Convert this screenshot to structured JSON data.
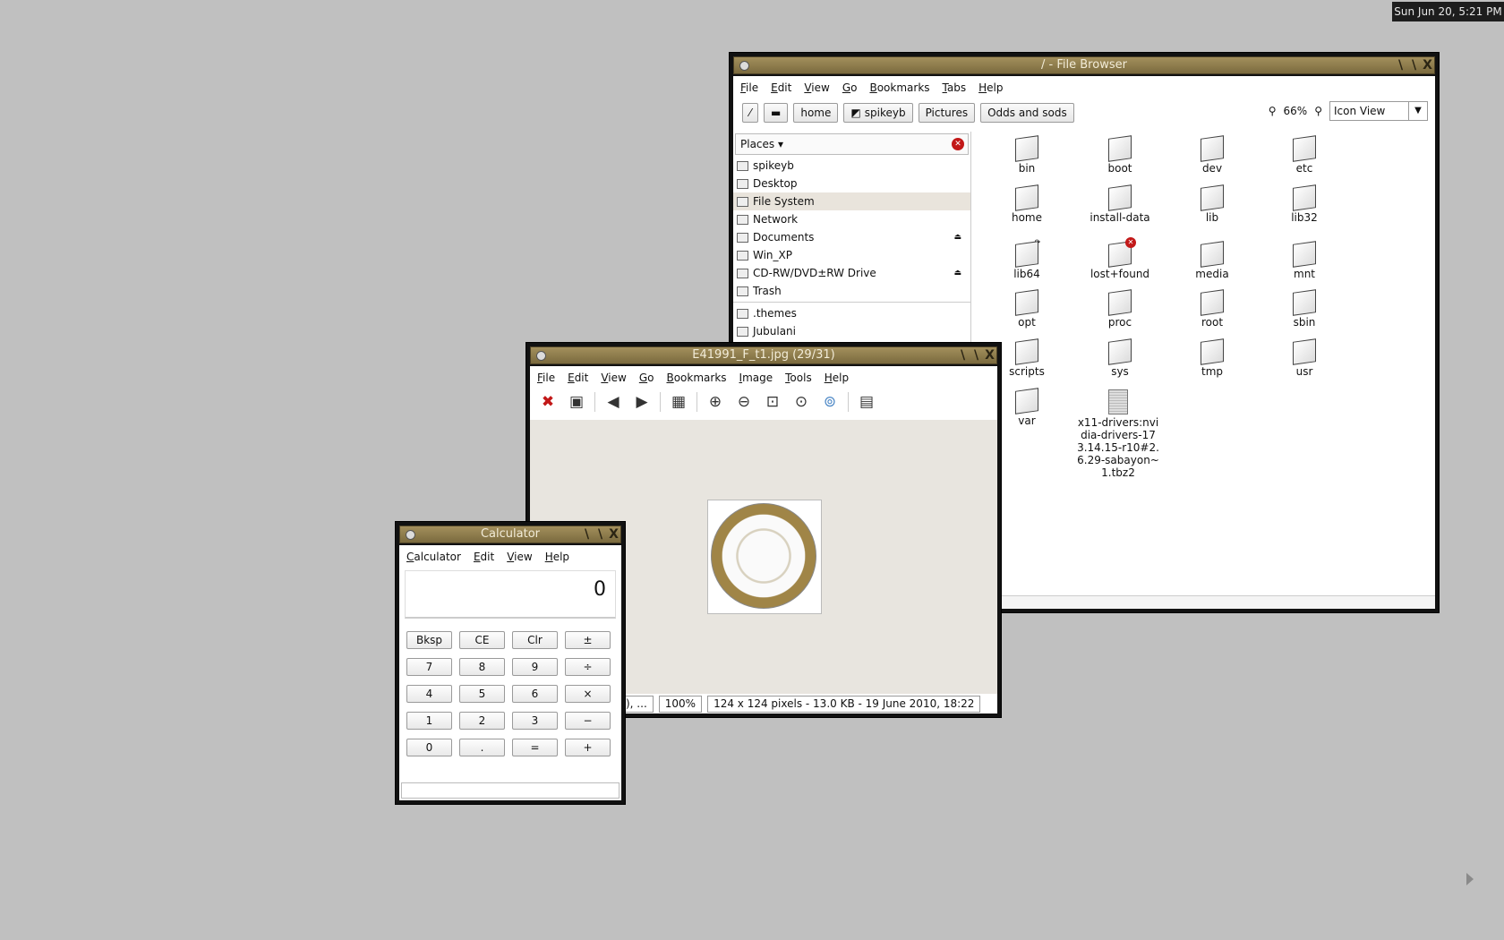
{
  "clock": "Sun Jun 20, 5:21 PM",
  "file_browser": {
    "title": "/ - File Browser",
    "menu": [
      "File",
      "Edit",
      "View",
      "Go",
      "Bookmarks",
      "Tabs",
      "Help"
    ],
    "path_buttons": [
      "home",
      "spikeyb",
      "Pictures",
      "Odds and sods"
    ],
    "zoom": "66%",
    "view_mode": "Icon View",
    "places_label": "Places",
    "places": [
      {
        "label": "spikeyb",
        "eject": false
      },
      {
        "label": "Desktop",
        "eject": false
      },
      {
        "label": "File System",
        "eject": false,
        "selected": true
      },
      {
        "label": "Network",
        "eject": false
      },
      {
        "label": "Documents",
        "eject": true
      },
      {
        "label": "Win_XP",
        "eject": false
      },
      {
        "label": "CD-RW/DVD±RW Drive",
        "eject": true
      },
      {
        "label": "Trash",
        "eject": false
      }
    ],
    "bookmarks": [
      ".themes",
      "Jubulani"
    ],
    "items": [
      "bin",
      "boot",
      "dev",
      "etc",
      "home",
      "install-data",
      "lib",
      "lib32",
      "lib64",
      "lost+found",
      "media",
      "mnt",
      "opt",
      "proc",
      "root",
      "sbin",
      "scripts",
      "sys",
      "tmp",
      "usr",
      "var",
      "x11-drivers:nvidia-drivers-173.14.15-r10#2.6.29-sabayon~1.tbz2"
    ]
  },
  "image_viewer": {
    "title": "E41991_F_t1.jpg  (29/31)",
    "menu": [
      "File",
      "Edit",
      "View",
      "Go",
      "Bookmarks",
      "Image",
      "Tools",
      "Help"
    ],
    "status_partial": "), ...",
    "status_zoom": "100%",
    "status_info": "124 x 124 pixels - 13.0 KB - 19 June 2010, 18:22"
  },
  "calculator": {
    "title": "Calculator",
    "menu": [
      "Calculator",
      "Edit",
      "View",
      "Help"
    ],
    "display": "0",
    "keys": [
      "Bksp",
      "CE",
      "Clr",
      "±",
      "7",
      "8",
      "9",
      "÷",
      "4",
      "5",
      "6",
      "×",
      "1",
      "2",
      "3",
      "−",
      "0",
      ".",
      "=",
      "+"
    ]
  }
}
